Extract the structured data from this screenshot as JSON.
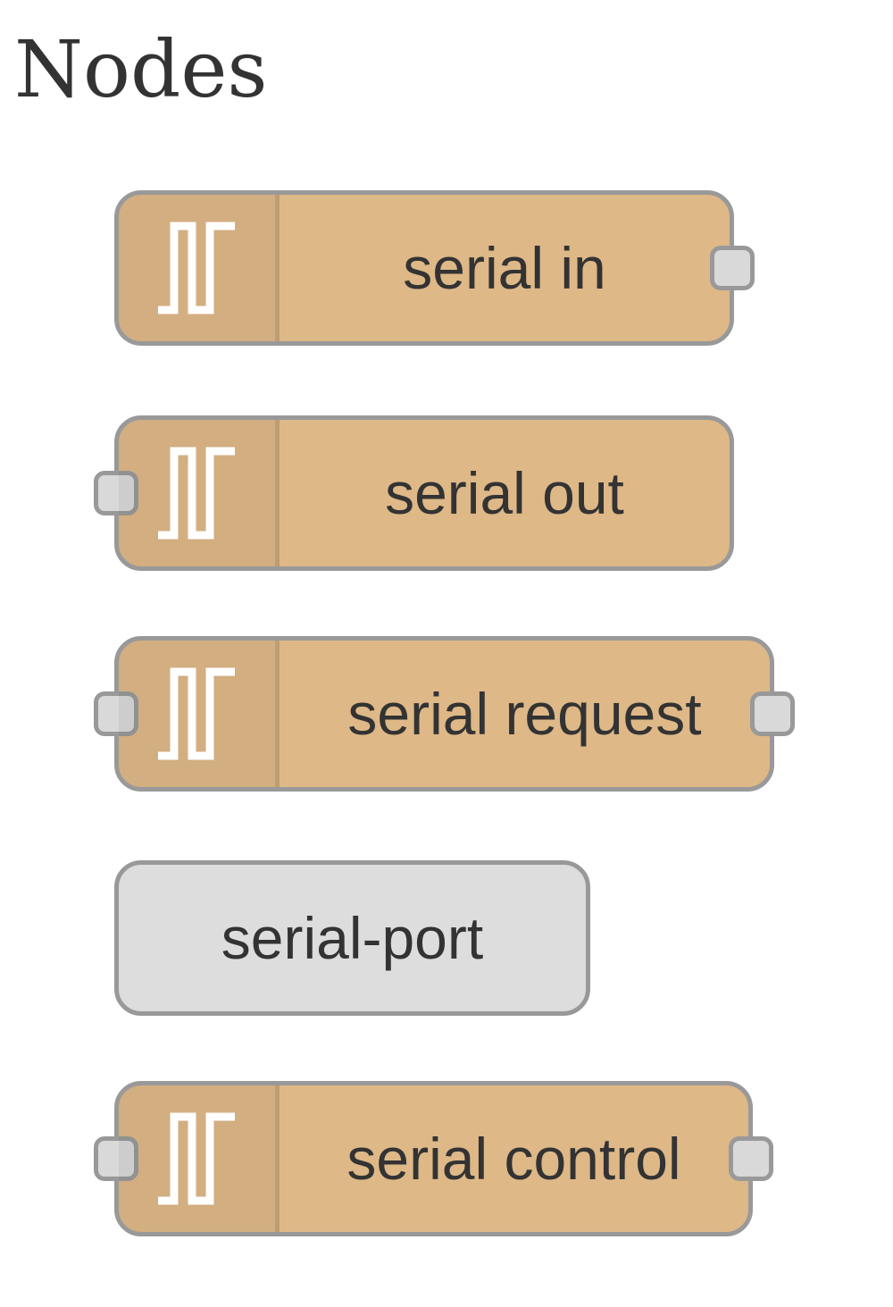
{
  "title": "Nodes",
  "nodes": [
    {
      "label": "serial in",
      "icon": "serial-icon",
      "color": "#deb887",
      "input": false,
      "output": true
    },
    {
      "label": "serial out",
      "icon": "serial-icon",
      "color": "#deb887",
      "input": true,
      "output": false
    },
    {
      "label": "serial request",
      "icon": "serial-icon",
      "color": "#deb887",
      "input": true,
      "output": true
    },
    {
      "label": "serial-port",
      "icon": null,
      "color": "#dddddd",
      "input": false,
      "output": false
    },
    {
      "label": "serial control",
      "icon": "serial-icon",
      "color": "#deb887",
      "input": true,
      "output": true
    }
  ]
}
